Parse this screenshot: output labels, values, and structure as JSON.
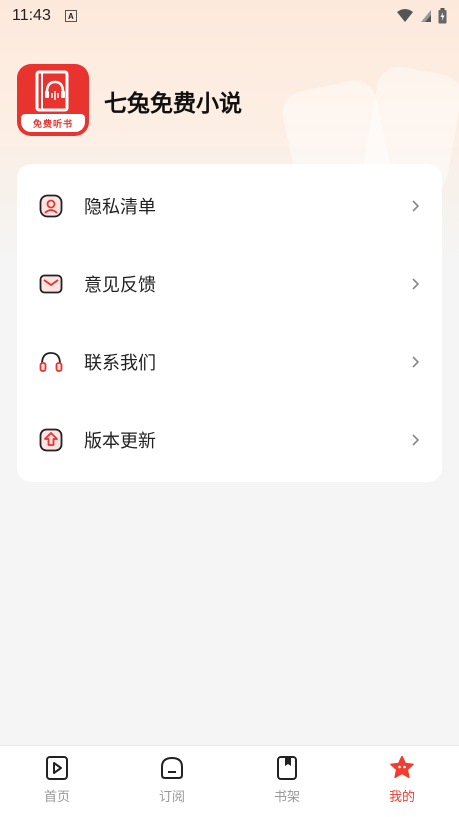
{
  "status_bar": {
    "time": "11:43",
    "notification_icon": "a-box-icon",
    "icons": [
      "wifi-icon",
      "signal-icon",
      "battery-charging-icon"
    ]
  },
  "app": {
    "name": "七兔免费小说",
    "logo_banner": "免费听书",
    "accent_color": "#e8332e"
  },
  "menu": {
    "items": [
      {
        "label": "隐私清单",
        "icon": "privacy-icon"
      },
      {
        "label": "意见反馈",
        "icon": "mail-icon"
      },
      {
        "label": "联系我们",
        "icon": "headset-icon"
      },
      {
        "label": "版本更新",
        "icon": "update-icon"
      }
    ]
  },
  "tabbar": {
    "items": [
      {
        "label": "首页",
        "icon": "play-book-icon",
        "active": false
      },
      {
        "label": "订阅",
        "icon": "subscribe-icon",
        "active": false
      },
      {
        "label": "书架",
        "icon": "bookmark-icon",
        "active": false
      },
      {
        "label": "我的",
        "icon": "star-face-icon",
        "active": true
      }
    ],
    "active_color": "#f23c30"
  }
}
